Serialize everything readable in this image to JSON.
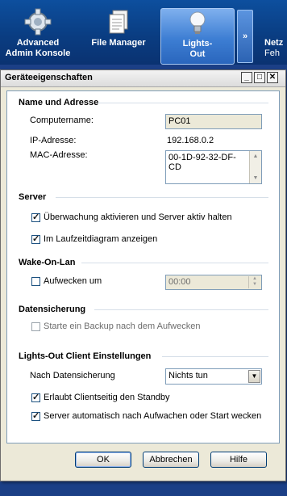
{
  "toolbar": {
    "items": [
      {
        "label_line1": "Advanced",
        "label_line2": "Admin Konsole",
        "icon": "gear-icon"
      },
      {
        "label_line1": "File Manager",
        "label_line2": "",
        "icon": "documents-icon"
      },
      {
        "label_line1": "Lights-",
        "label_line2": "Out",
        "icon": "lightbulb-icon",
        "active": true
      }
    ],
    "more_label": "»",
    "partial_line1": "Netz",
    "partial_line2": "Feh"
  },
  "dialog": {
    "title": "Geräteeigenschaften",
    "sections": {
      "name_address": {
        "heading": "Name und Adresse",
        "computername_label": "Computername:",
        "computername_value": "PC01",
        "ip_label": "IP-Adresse:",
        "ip_value": "192.168.0.2",
        "mac_label": "MAC-Adresse:",
        "mac_value": "00-1D-92-32-DF-CD"
      },
      "server": {
        "heading": "Server",
        "monitor_label": "Überwachung aktivieren und Server aktiv halten",
        "monitor_checked": true,
        "runtime_label": "Im Laufzeitdiagram anzeigen",
        "runtime_checked": true
      },
      "wol": {
        "heading": "Wake-On-Lan",
        "wake_label": "Aufwecken um",
        "wake_checked": false,
        "time_value": "00:00"
      },
      "backup": {
        "heading": "Datensicherung",
        "start_backup_label": "Starte ein Backup nach dem Aufwecken",
        "start_backup_checked": false
      },
      "client": {
        "heading": "Lights-Out Client Einstellungen",
        "after_backup_label": "Nach Datensicherung",
        "after_backup_value": "Nichts tun",
        "standby_label": "Erlaubt Clientseitig den Standby",
        "standby_checked": true,
        "wake_server_label": "Server automatisch nach Aufwachen oder Start wecken",
        "wake_server_checked": true
      }
    },
    "buttons": {
      "ok": "OK",
      "cancel": "Abbrechen",
      "help": "Hilfe"
    }
  }
}
